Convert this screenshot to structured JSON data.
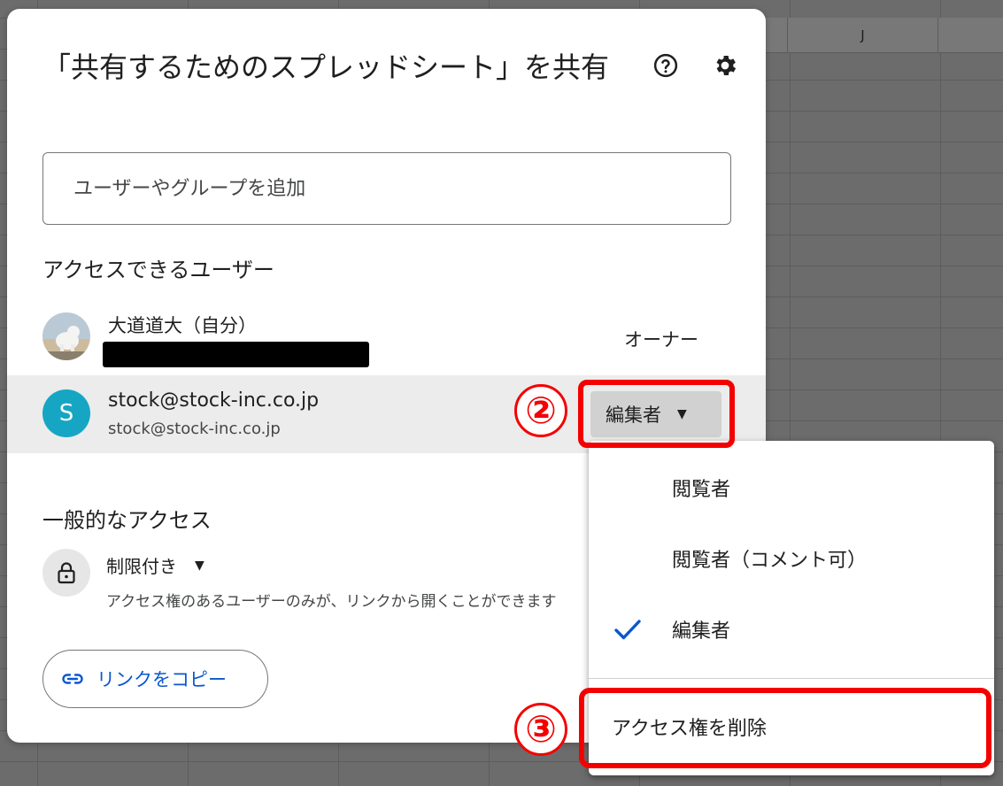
{
  "spreadsheet": {
    "column_j": "J"
  },
  "dialog": {
    "title": "「共有するためのスプレッドシート」を共有",
    "add_placeholder": "ユーザーやグループを追加",
    "people_heading": "アクセスできるユーザー",
    "owner": {
      "name": "大道道大（自分）",
      "role": "オーナー"
    },
    "collaborator": {
      "initial": "S",
      "name": "stock@stock-inc.co.jp",
      "email": "stock@stock-inc.co.jp",
      "role": "編集者"
    },
    "general_heading": "一般的なアクセス",
    "access_level": "制限付き",
    "access_desc": "アクセス権のあるユーザーのみが、リンクから開くことができます",
    "copy_link": "リンクをコピー"
  },
  "role_menu": {
    "viewer": "閲覧者",
    "commenter": "閲覧者（コメント可）",
    "editor": "編集者",
    "remove": "アクセス権を削除"
  },
  "annotations": {
    "step2": "②",
    "step3": "③"
  },
  "colors": {
    "accent_blue": "#0b57d0",
    "avatar_teal": "#16a6c4",
    "highlight_red": "#f40000"
  },
  "icons": [
    "help-icon",
    "settings-icon",
    "lock-icon",
    "link-icon",
    "check-icon",
    "dropdown-caret-icon"
  ]
}
